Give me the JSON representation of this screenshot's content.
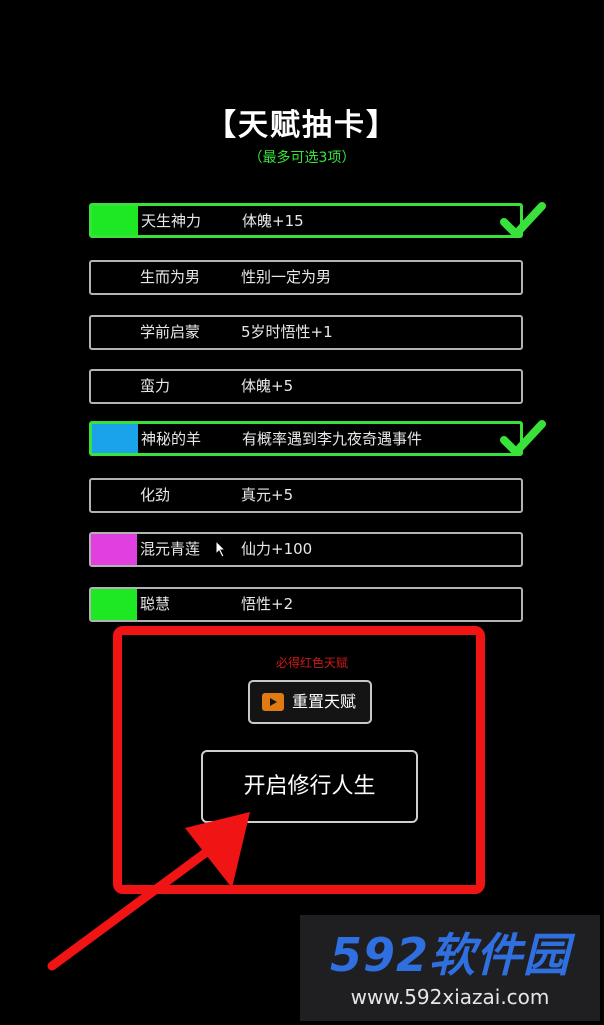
{
  "header": {
    "title": "【天赋抽卡】",
    "subtitle": "（最多可选3项）"
  },
  "talents": [
    {
      "name": "天生神力",
      "desc": "体魄+15",
      "color": "#1ee823",
      "selected": true
    },
    {
      "name": "生而为男",
      "desc": "性别一定为男",
      "color": "",
      "selected": false
    },
    {
      "name": "学前启蒙",
      "desc": "5岁时悟性+1",
      "color": "",
      "selected": false
    },
    {
      "name": "蛮力",
      "desc": "体魄+5",
      "color": "",
      "selected": false
    },
    {
      "name": "神秘的羊",
      "desc": "有概率遇到李九夜奇遇事件",
      "color": "#1aa3e8",
      "selected": true
    },
    {
      "name": "化劲",
      "desc": "真元+5",
      "color": "",
      "selected": false
    },
    {
      "name": "混元青莲",
      "desc": "仙力+100",
      "color": "#e040e0",
      "selected": false
    },
    {
      "name": "聪慧",
      "desc": "悟性+2",
      "color": "#1ee823",
      "selected": false
    }
  ],
  "actions": {
    "hint": "必得红色天赋",
    "reset_label": "重置天赋",
    "start_label": "开启修行人生"
  },
  "watermark": {
    "logo": "592软件园",
    "url": "www.592xiazai.com"
  },
  "colors": {
    "background": "#000000",
    "accent_green": "#39e23a",
    "highlight_red": "#f01414"
  }
}
